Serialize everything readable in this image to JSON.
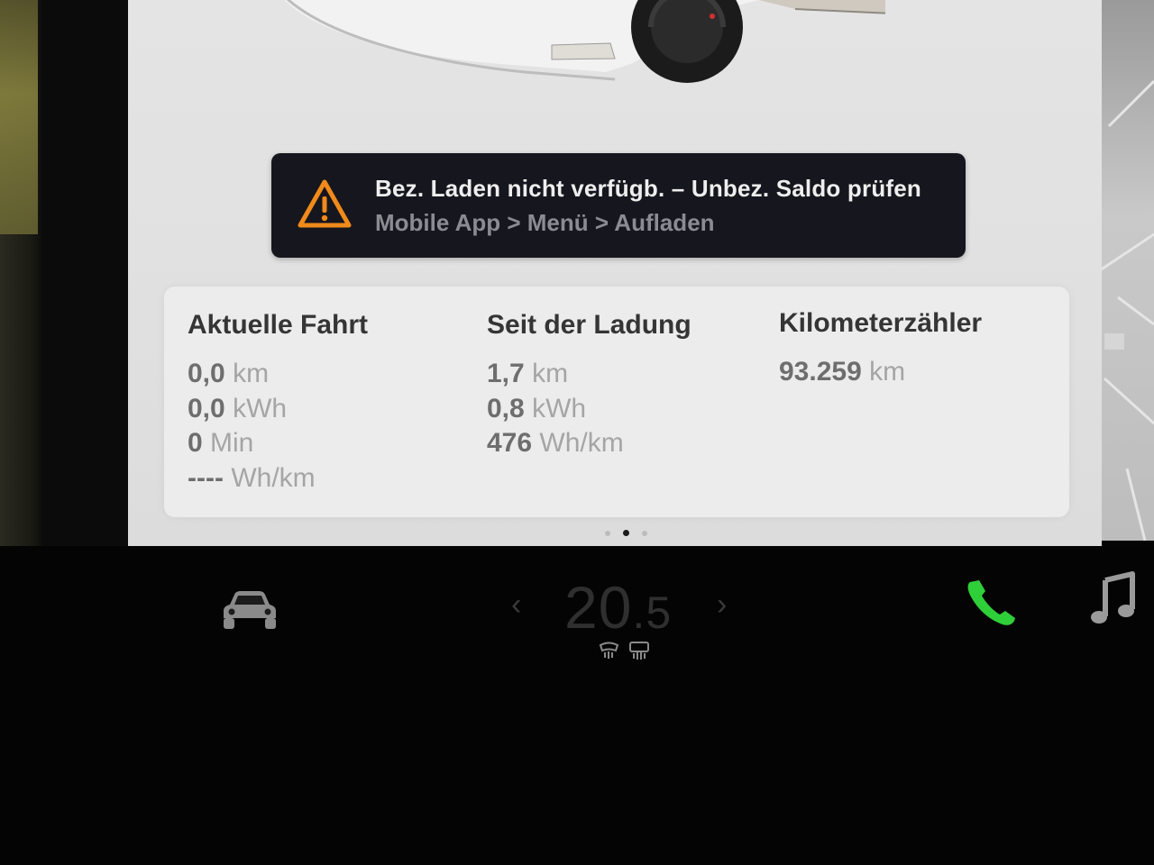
{
  "alert": {
    "icon": "warning-triangle-icon",
    "accent_color": "#f08a1a",
    "title": "Bez. Laden nicht verfügb. – Unbez. Saldo prüfen",
    "subtitle": "Mobile App > Menü > Aufladen"
  },
  "trip": {
    "current": {
      "heading": "Aktuelle Fahrt",
      "rows": [
        {
          "value": "0,0",
          "unit": "km"
        },
        {
          "value": "0,0",
          "unit": "kWh"
        },
        {
          "value": "0",
          "unit": "Min"
        },
        {
          "value": "----",
          "unit": "Wh/km"
        }
      ]
    },
    "since_charge": {
      "heading": "Seit der Ladung",
      "rows": [
        {
          "value": "1,7",
          "unit": "km"
        },
        {
          "value": "0,8",
          "unit": "kWh"
        },
        {
          "value": "476",
          "unit": "Wh/km"
        }
      ]
    },
    "odometer": {
      "heading": "Kilometerzähler",
      "rows": [
        {
          "value": "93.259",
          "unit": "km"
        }
      ]
    }
  },
  "pagination": {
    "total": 3,
    "active": 2
  },
  "dock": {
    "car_icon": "car-icon",
    "temp_left": "‹",
    "temp_right": "›",
    "temperature_whole": "20",
    "temperature_decimal": ".5",
    "defrost_icons": [
      "rear-defrost-icon",
      "front-defrost-icon"
    ],
    "phone_icon": "phone-icon",
    "phone_color": "#2fcf3a",
    "music_icon": "music-note-icon"
  }
}
